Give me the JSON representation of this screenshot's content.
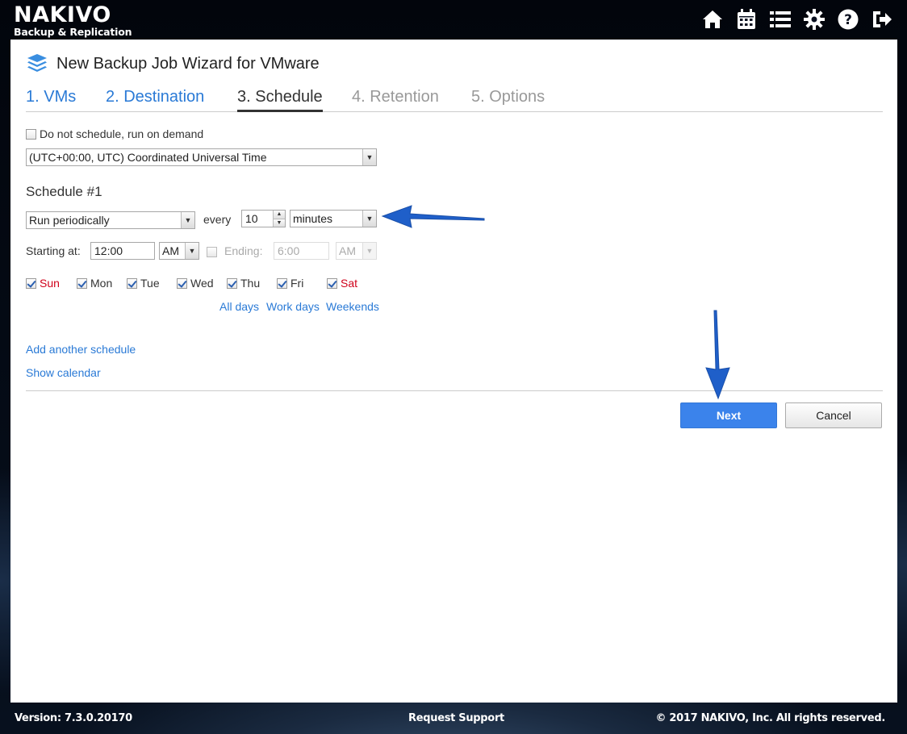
{
  "app": {
    "brand": "NAKIVO",
    "subtitle": "Backup & Replication"
  },
  "topbar": {
    "icons": [
      "home-icon",
      "calendar-icon",
      "list-icon",
      "gear-icon",
      "help-icon",
      "logout-icon"
    ]
  },
  "wizard": {
    "title": "New Backup Job Wizard for VMware",
    "tabs": [
      {
        "label": "1. VMs",
        "state": "done"
      },
      {
        "label": "2. Destination",
        "state": "done"
      },
      {
        "label": "3. Schedule",
        "state": "active"
      },
      {
        "label": "4. Retention",
        "state": "disabled"
      },
      {
        "label": "5. Options",
        "state": "disabled"
      }
    ]
  },
  "schedule": {
    "on_demand_label": "Do not schedule, run on demand",
    "on_demand_checked": false,
    "timezone": "(UTC+00:00, UTC) Coordinated Universal Time",
    "heading": "Schedule #1",
    "mode": "Run periodically",
    "every_label": "every",
    "interval_value": "10",
    "interval_unit": "minutes",
    "starting_label": "Starting at:",
    "start_time": "12:00",
    "start_ampm": "AM",
    "ending_checked": false,
    "ending_label": "Ending:",
    "end_time": "6:00",
    "end_ampm": "AM",
    "days": [
      {
        "label": "Sun",
        "checked": true,
        "weekend": true
      },
      {
        "label": "Mon",
        "checked": true,
        "weekend": false
      },
      {
        "label": "Tue",
        "checked": true,
        "weekend": false
      },
      {
        "label": "Wed",
        "checked": true,
        "weekend": false
      },
      {
        "label": "Thu",
        "checked": true,
        "weekend": false
      },
      {
        "label": "Fri",
        "checked": true,
        "weekend": false
      },
      {
        "label": "Sat",
        "checked": true,
        "weekend": true
      }
    ],
    "quick_links": {
      "all_days": "All days",
      "work_days": "Work days",
      "weekends": "Weekends"
    },
    "add_schedule": "Add another schedule",
    "show_calendar": "Show calendar"
  },
  "buttons": {
    "next": "Next",
    "cancel": "Cancel"
  },
  "footer": {
    "version": "Version: 7.3.0.20170",
    "support": "Request Support",
    "copyright": "© 2017 NAKIVO, Inc. All rights reserved."
  },
  "colors": {
    "accent": "#2a7ad6",
    "primary_button": "#3b83eb",
    "weekend": "#d0021b",
    "annotation_arrow": "#1f5fc9"
  }
}
